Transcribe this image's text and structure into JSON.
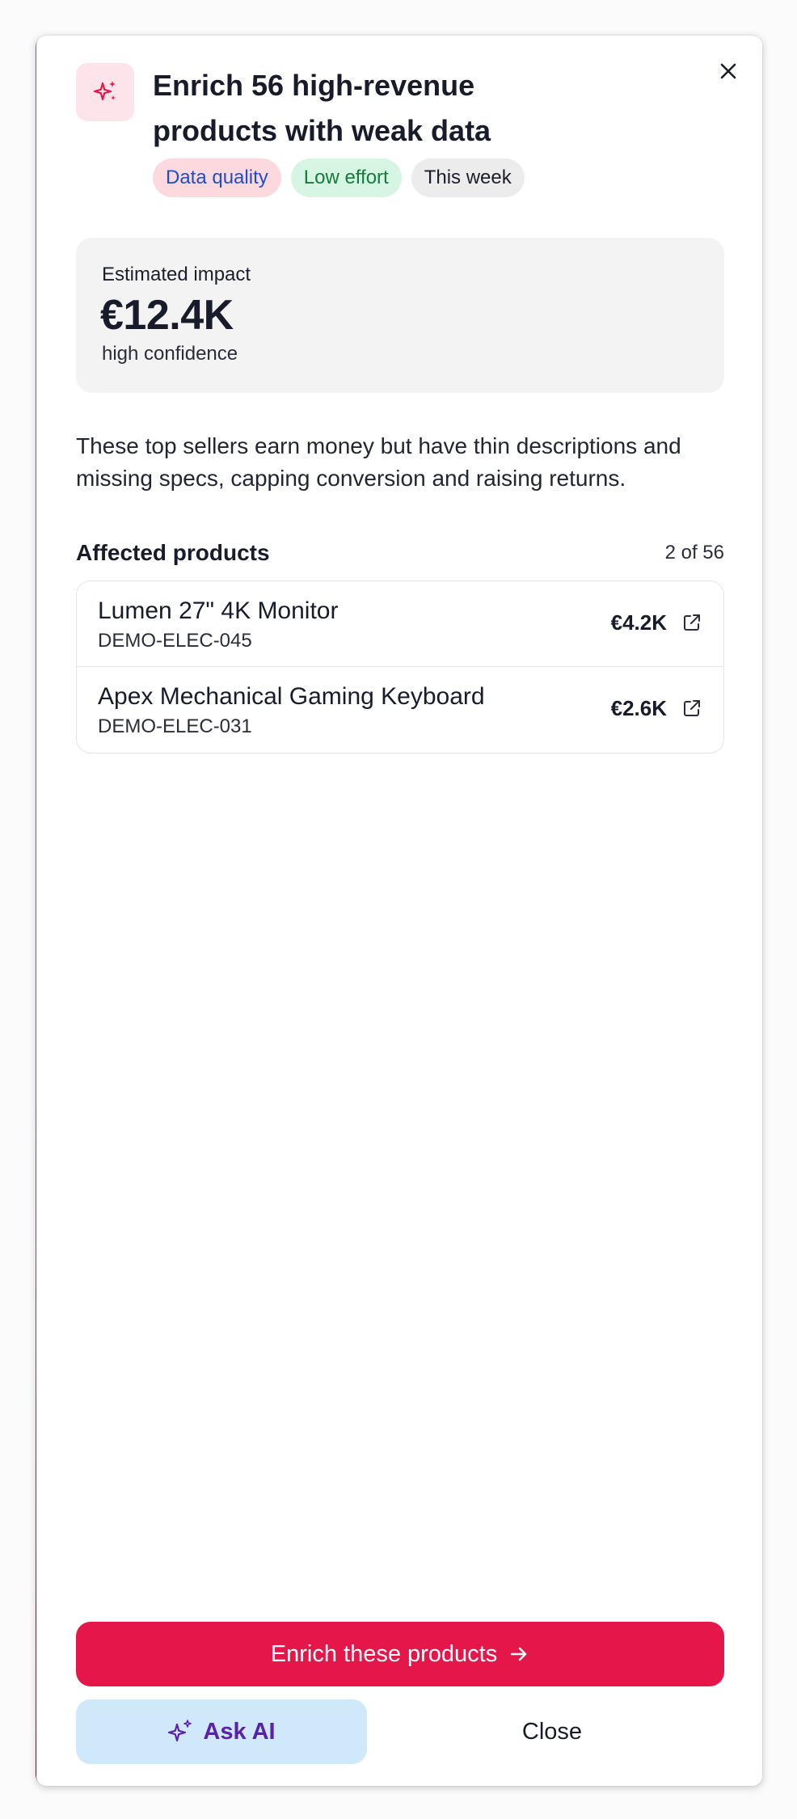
{
  "dialog": {
    "title": "Enrich 56 high-revenue products with weak data",
    "icon": "sparkles-icon",
    "close_icon": "close-icon",
    "tags": [
      {
        "label": "Data quality",
        "color": "#1d4ec9",
        "bg": "#fcd9de"
      },
      {
        "label": "Low effort",
        "color": "#157a3b",
        "bg": "#d6f5e2"
      },
      {
        "label": "This week",
        "color": "#1b1e29",
        "bg": "#ececec"
      }
    ]
  },
  "impact": {
    "label": "Estimated impact",
    "value": "€12.4K",
    "confidence": "high confidence"
  },
  "description": "These top sellers earn money but have thin descriptions and missing specs, capping conversion and raising returns.",
  "affected": {
    "title": "Affected products",
    "count": "2 of 56",
    "products": [
      {
        "name": "Lumen 27\" 4K Monitor",
        "sku": "DEMO-ELEC-045",
        "amount": "€4.2K",
        "icon": "external-link-icon"
      },
      {
        "name": "Apex Mechanical Gaming Keyboard",
        "sku": "DEMO-ELEC-031",
        "amount": "€2.6K",
        "icon": "external-link-icon"
      }
    ]
  },
  "actions": {
    "primary_label": "Enrich these products",
    "primary_icon": "arrow-right-icon",
    "ask_ai_label": "Ask AI",
    "ask_ai_icon": "sparkles-icon",
    "close_label": "Close"
  },
  "colors": {
    "accent": "#e4164a",
    "ask_ai_bg": "#cfe8fa",
    "ask_ai_text": "#5a22a8",
    "icon_tile_bg": "#fde4ea"
  }
}
